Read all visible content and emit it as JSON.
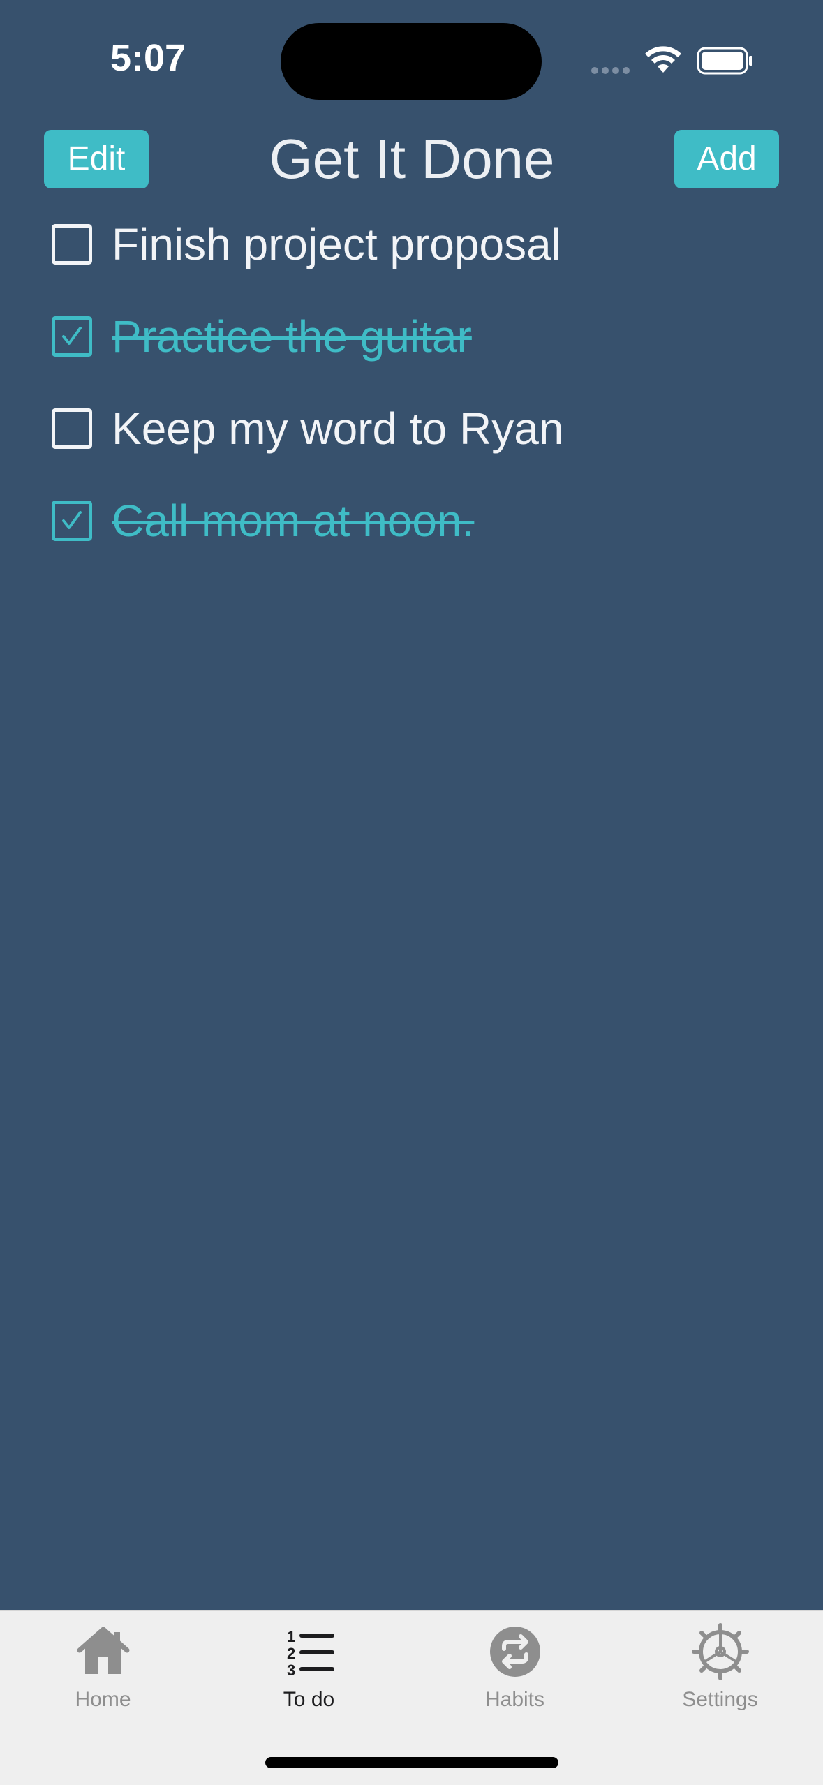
{
  "status_bar": {
    "time": "5:07"
  },
  "nav": {
    "title": "Get It Done",
    "edit_label": "Edit",
    "add_label": "Add"
  },
  "todos": [
    {
      "text": "Finish project proposal",
      "done": false
    },
    {
      "text": "Practice the guitar",
      "done": true
    },
    {
      "text": "Keep my word to Ryan",
      "done": false
    },
    {
      "text": "Call mom at noon.",
      "done": true
    }
  ],
  "tabs": [
    {
      "label": "Home",
      "icon": "house-icon",
      "active": false
    },
    {
      "label": "To do",
      "icon": "numbered-list-icon",
      "active": true
    },
    {
      "label": "Habits",
      "icon": "repeat-icon",
      "active": false
    },
    {
      "label": "Settings",
      "icon": "gear-icon",
      "active": false
    }
  ],
  "colors": {
    "background": "#37516d",
    "accent": "#3fbcc6",
    "text": "#f2f4f7",
    "tab_bar": "#efefef",
    "tab_inactive": "#8e8e8e",
    "tab_active": "#1c1c1e"
  }
}
